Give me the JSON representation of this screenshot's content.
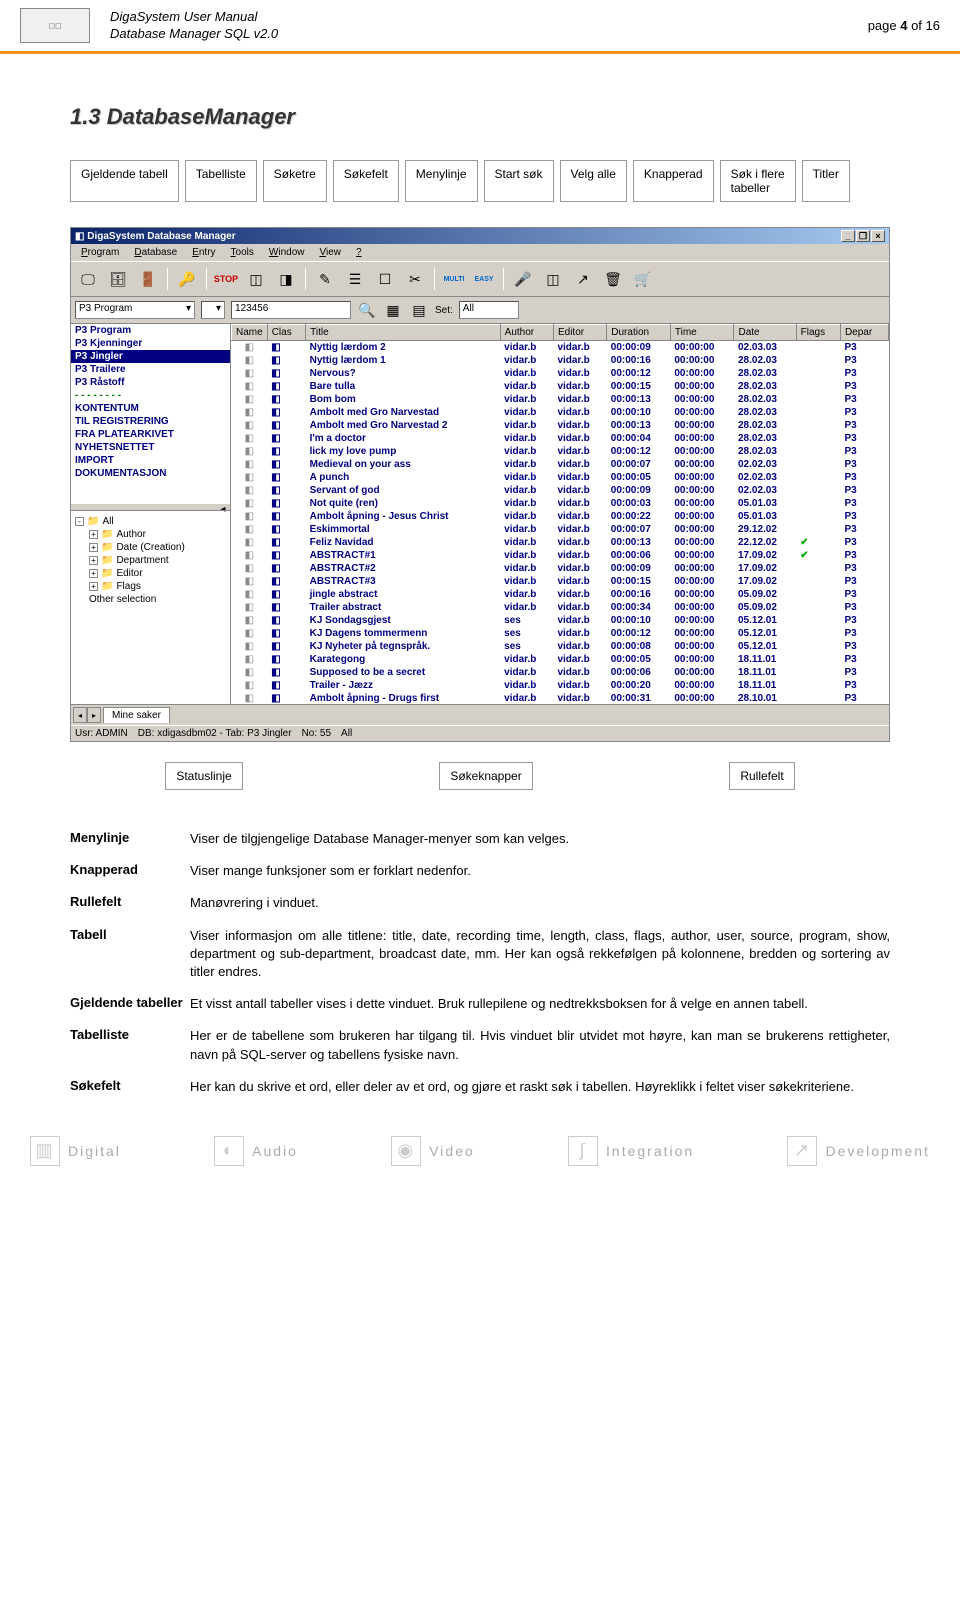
{
  "header": {
    "line1": "DigaSystem User Manual",
    "line2": "Database Manager SQL v2.0",
    "page": "page 4 of 16"
  },
  "section_title": "1.3 DatabaseManager",
  "callouts_top": {
    "gjeldende_tabell": "Gjeldende tabell",
    "tabelliste": "Tabelliste",
    "soketre": "Søketre",
    "sokefelt": "Søkefelt",
    "menylinje": "Menylinje",
    "start_sok": "Start søk",
    "velg_alle": "Velg alle",
    "knapperad": "Knapperad",
    "sok_i_flere": "Søk i flere\ntabeller",
    "titler": "Titler"
  },
  "callouts_bottom": {
    "statuslinje": "Statuslinje",
    "sokeknapper": "Søkeknapper",
    "rullefelt": "Rullefelt"
  },
  "app": {
    "title": "DigaSystem Database Manager",
    "menu": [
      "Program",
      "Database",
      "Entry",
      "Tools",
      "Window",
      "View",
      "?"
    ],
    "combo1": "P3 Program",
    "textfield1": "123456",
    "setlabel": "Set:",
    "setvalue": "All",
    "multi": "MULTI",
    "easy": "EASY",
    "tables": [
      "P3 Program",
      "P3 Kjenninger",
      "P3 Jingler",
      "P3 Trailere",
      "P3 Råstoff",
      "- - - - - - - -",
      "KONTENTUM",
      "TIL REGISTRERING",
      "FRA PLATEARKIVET",
      "NYHETSNETTET",
      "IMPORT",
      "DOKUMENTASJON"
    ],
    "tree": [
      {
        "box": "-",
        "label": "All",
        "folder": true
      },
      {
        "box": "+",
        "label": "Author",
        "folder": true,
        "indent": 1
      },
      {
        "box": "+",
        "label": "Date (Creation)",
        "folder": true,
        "indent": 1
      },
      {
        "box": "+",
        "label": "Department",
        "folder": true,
        "indent": 1
      },
      {
        "box": "+",
        "label": "Editor",
        "folder": true,
        "indent": 1
      },
      {
        "box": "+",
        "label": "Flags",
        "folder": true,
        "indent": 1
      },
      {
        "box": "",
        "label": "Other selection",
        "folder": false,
        "indent": 1
      }
    ],
    "columns": [
      "Name",
      "Clas",
      "Title",
      "Author",
      "Editor",
      "Duration",
      "Time",
      "Date",
      "Flags",
      "Depar"
    ],
    "rows": [
      [
        "",
        "Nyttig lærdom 2",
        "vidar.b",
        "vidar.b",
        "00:00:09",
        "00:00:00",
        "02.03.03",
        "",
        "P3"
      ],
      [
        "",
        "Nyttig lærdom 1",
        "vidar.b",
        "vidar.b",
        "00:00:16",
        "00:00:00",
        "28.02.03",
        "",
        "P3"
      ],
      [
        "",
        "Nervous?",
        "vidar.b",
        "vidar.b",
        "00:00:12",
        "00:00:00",
        "28.02.03",
        "",
        "P3"
      ],
      [
        "",
        "Bare tulla",
        "vidar.b",
        "vidar.b",
        "00:00:15",
        "00:00:00",
        "28.02.03",
        "",
        "P3"
      ],
      [
        "",
        "Bom bom",
        "vidar.b",
        "vidar.b",
        "00:00:13",
        "00:00:00",
        "28.02.03",
        "",
        "P3"
      ],
      [
        "",
        "Ambolt med Gro Narvestad",
        "vidar.b",
        "vidar.b",
        "00:00:10",
        "00:00:00",
        "28.02.03",
        "",
        "P3"
      ],
      [
        "",
        "Ambolt med Gro Narvestad 2",
        "vidar.b",
        "vidar.b",
        "00:00:13",
        "00:00:00",
        "28.02.03",
        "",
        "P3"
      ],
      [
        "",
        "I'm a doctor",
        "vidar.b",
        "vidar.b",
        "00:00:04",
        "00:00:00",
        "28.02.03",
        "",
        "P3"
      ],
      [
        "",
        "lick my love pump",
        "vidar.b",
        "vidar.b",
        "00:00:12",
        "00:00:00",
        "28.02.03",
        "",
        "P3"
      ],
      [
        "",
        "Medieval on your ass",
        "vidar.b",
        "vidar.b",
        "00:00:07",
        "00:00:00",
        "02.02.03",
        "",
        "P3"
      ],
      [
        "",
        "A punch",
        "vidar.b",
        "vidar.b",
        "00:00:05",
        "00:00:00",
        "02.02.03",
        "",
        "P3"
      ],
      [
        "",
        "Servant of god",
        "vidar.b",
        "vidar.b",
        "00:00:09",
        "00:00:00",
        "02.02.03",
        "",
        "P3"
      ],
      [
        "",
        "Not quite (ren)",
        "vidar.b",
        "vidar.b",
        "00:00:03",
        "00:00:00",
        "05.01.03",
        "",
        "P3"
      ],
      [
        "",
        "Ambolt åpning - Jesus Christ",
        "vidar.b",
        "vidar.b",
        "00:00:22",
        "00:00:00",
        "05.01.03",
        "",
        "P3"
      ],
      [
        "",
        "Eskimmortal",
        "vidar.b",
        "vidar.b",
        "00:00:07",
        "00:00:00",
        "29.12.02",
        "",
        "P3"
      ],
      [
        "",
        "Feliz Navidad",
        "vidar.b",
        "vidar.b",
        "00:00:13",
        "00:00:00",
        "22.12.02",
        "✔",
        "P3"
      ],
      [
        "",
        "ABSTRACT#1",
        "vidar.b",
        "vidar.b",
        "00:00:06",
        "00:00:00",
        "17.09.02",
        "✔",
        "P3"
      ],
      [
        "",
        "ABSTRACT#2",
        "vidar.b",
        "vidar.b",
        "00:00:09",
        "00:00:00",
        "17.09.02",
        "",
        "P3"
      ],
      [
        "",
        "ABSTRACT#3",
        "vidar.b",
        "vidar.b",
        "00:00:15",
        "00:00:00",
        "17.09.02",
        "",
        "P3"
      ],
      [
        "",
        "jingle abstract",
        "vidar.b",
        "vidar.b",
        "00:00:16",
        "00:00:00",
        "05.09.02",
        "",
        "P3"
      ],
      [
        "",
        "Trailer abstract",
        "vidar.b",
        "vidar.b",
        "00:00:34",
        "00:00:00",
        "05.09.02",
        "",
        "P3"
      ],
      [
        "",
        "KJ Sondagsgjest",
        "ses",
        "vidar.b",
        "00:00:10",
        "00:00:00",
        "05.12.01",
        "",
        "P3"
      ],
      [
        "",
        "KJ Dagens tommermenn",
        "ses",
        "vidar.b",
        "00:00:12",
        "00:00:00",
        "05.12.01",
        "",
        "P3"
      ],
      [
        "",
        "KJ Nyheter på tegnspråk.",
        "ses",
        "vidar.b",
        "00:00:08",
        "00:00:00",
        "05.12.01",
        "",
        "P3"
      ],
      [
        "",
        "Karategong",
        "vidar.b",
        "vidar.b",
        "00:00:05",
        "00:00:00",
        "18.11.01",
        "",
        "P3"
      ],
      [
        "",
        "Supposed to be a secret",
        "vidar.b",
        "vidar.b",
        "00:00:06",
        "00:00:00",
        "18.11.01",
        "",
        "P3"
      ],
      [
        "",
        "Trailer - Jæzz",
        "vidar.b",
        "vidar.b",
        "00:00:20",
        "00:00:00",
        "18.11.01",
        "",
        "P3"
      ],
      [
        "",
        "Ambolt åpning - Drugs first",
        "vidar.b",
        "vidar.b",
        "00:00:31",
        "00:00:00",
        "28.10.01",
        "",
        "P3"
      ]
    ],
    "tab": "Mine saker",
    "status": {
      "usr": "Usr: ADMIN",
      "db": "DB: xdigasdbm02 - Tab: P3 Jingler",
      "no": "No: 55",
      "all": "All"
    }
  },
  "defs": [
    {
      "term": "Menylinje",
      "desc": "Viser de tilgjengelige Database Manager-menyer som kan velges."
    },
    {
      "term": "Knapperad",
      "desc": "Viser mange funksjoner som er forklart nedenfor."
    },
    {
      "term": "Rullefelt",
      "desc": "Manøvrering i vinduet."
    },
    {
      "term": "Tabell",
      "desc": "Viser informasjon om alle titlene: title, date, recording time, length, class, flags, author, user, source, program, show, department og sub-department, broadcast date, mm. Her kan også rekkefølgen på kolonnene, bredden og sortering av titler endres."
    },
    {
      "term": "Gjeldende tabeller",
      "desc": "Et visst antall tabeller vises i dette vinduet. Bruk rullepilene og nedtrekksboksen for å velge en annen tabell."
    },
    {
      "term": "Tabelliste",
      "desc": "Her er de tabellene som brukeren har tilgang til. Hvis vinduet blir utvidet mot høyre, kan man se brukerens rettigheter, navn på SQL-server og tabellens fysiske navn."
    },
    {
      "term": "Søkefelt",
      "desc": "Her kan du skrive et ord, eller deler av et ord, og gjøre et raskt søk i tabellen. Høyreklikk i feltet viser søkekriteriene."
    }
  ],
  "footer": [
    "Digital",
    "Audio",
    "Video",
    "Integration",
    "Development"
  ]
}
